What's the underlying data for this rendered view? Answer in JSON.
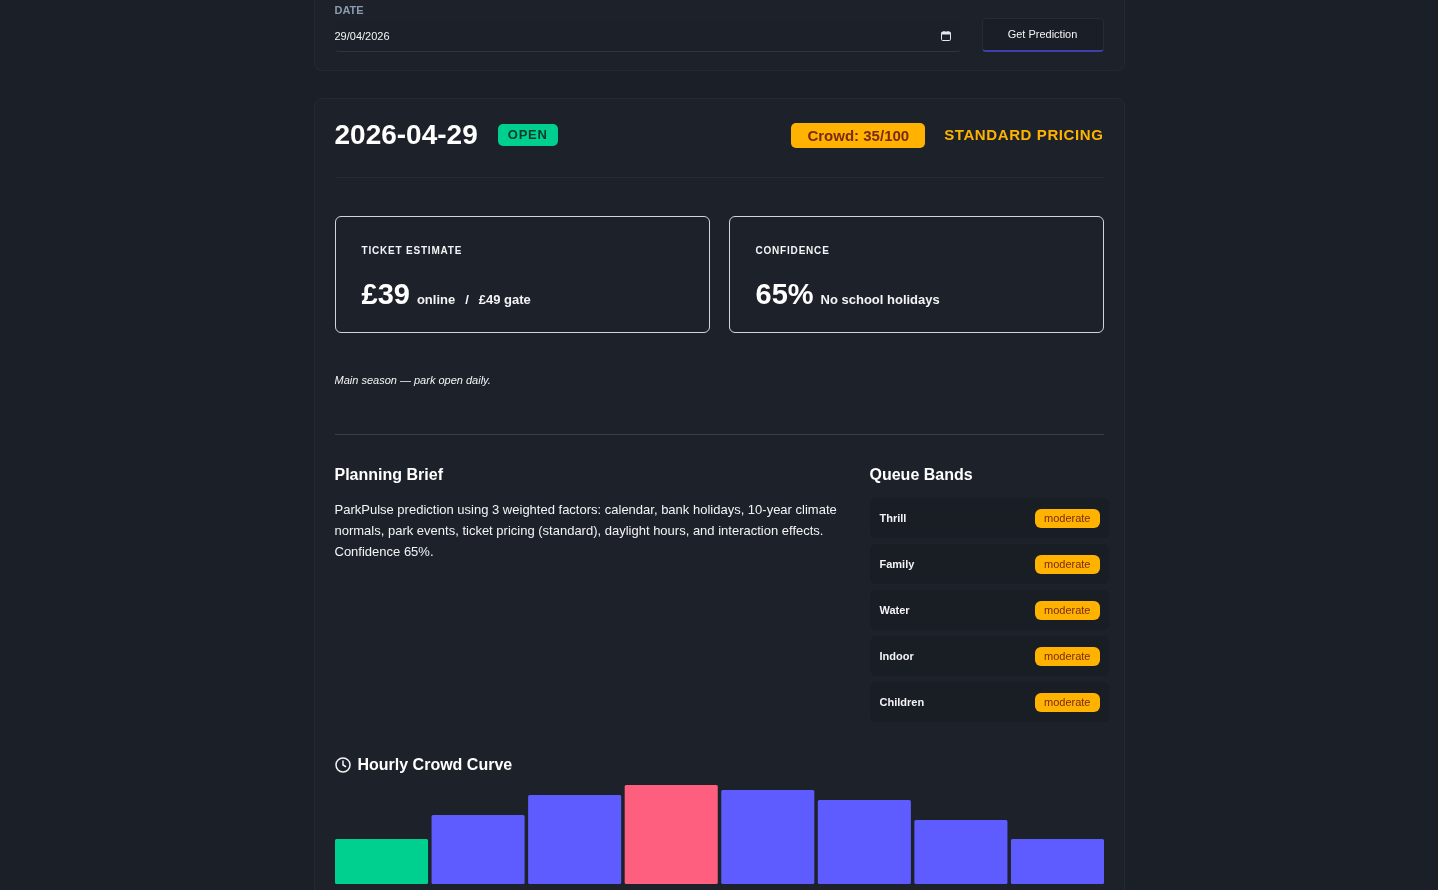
{
  "date_form": {
    "label": "DATE",
    "value": "29/04/2026",
    "button": "Get Prediction"
  },
  "summary": {
    "date": "2026-04-29",
    "status": {
      "label": "OPEN",
      "kind": "open"
    },
    "crowd": "Crowd: 35/100",
    "pricing": "STANDARD PRICING"
  },
  "stats": [
    {
      "label": "TICKET ESTIMATE",
      "value": "£39",
      "notes": [
        "online",
        "/",
        "£49 gate"
      ]
    },
    {
      "label": "CONFIDENCE",
      "value": "65%",
      "notes": [
        "No school holidays"
      ]
    }
  ],
  "season_note": "Main season — park open daily.",
  "planning_brief": {
    "title": "Planning Brief",
    "text": "ParkPulse prediction using 3 weighted factors: calendar, bank holidays, 10-year climate normals, park events, ticket pricing (standard), daylight hours, and interaction effects. Confidence 65%."
  },
  "queue_bands": {
    "title": "Queue Bands",
    "items": [
      {
        "name": "Thrill",
        "band": "moderate",
        "color": "#ffb300"
      },
      {
        "name": "Family",
        "band": "moderate",
        "color": "#ffb300"
      },
      {
        "name": "Water",
        "band": "moderate",
        "color": "#ffb300"
      },
      {
        "name": "Indoor",
        "band": "moderate",
        "color": "#ffb300"
      },
      {
        "name": "Children",
        "band": "moderate",
        "color": "#ffb300"
      }
    ]
  },
  "hourly_chart": {
    "title": "Hourly Crowd Curve"
  }
}
